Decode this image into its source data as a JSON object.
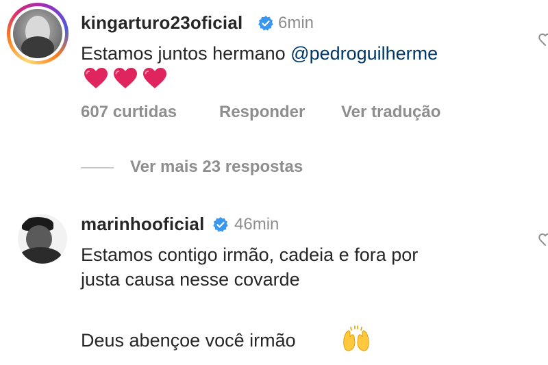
{
  "comments": [
    {
      "username": "kingarturo23oficial",
      "verified": true,
      "time": "6min",
      "text": "Estamos juntos hermano ",
      "mention": "@pedroguilherme",
      "emoji": [
        "red-heart",
        "red-heart",
        "red-heart"
      ],
      "likes_label": "607 curtidas",
      "reply_label": "Responder",
      "translate_label": "Ver tradução"
    },
    {
      "username": "marinhooficial",
      "verified": true,
      "time": "46min",
      "text_line1": "Estamos contigo irmão, cadeia e fora por",
      "text_line2": "justa causa nesse covarde",
      "text_line3": "Deus abençoe você irmão",
      "emoji": "raised-hands"
    }
  ],
  "view_replies_label": "Ver mais 23 respostas",
  "colors": {
    "text": "#262626",
    "muted": "#8e8e8e",
    "mention": "#00376b",
    "verified": "#3897f0",
    "heart": "#e0245e"
  }
}
